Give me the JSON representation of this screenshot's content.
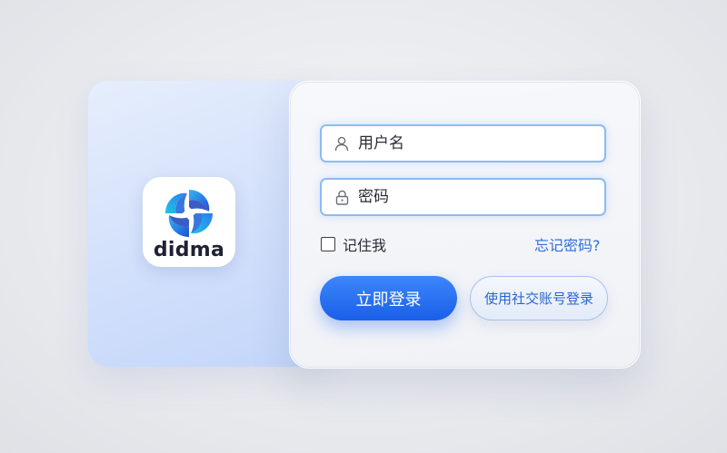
{
  "brand": {
    "name": "didma",
    "accent_color": "#1a5fe8"
  },
  "form": {
    "username": {
      "placeholder": "用户名",
      "icon": "user-icon"
    },
    "password": {
      "placeholder": "密码",
      "icon": "lock-icon"
    },
    "remember_label": "记住我",
    "forgot_label": "忘记密码?",
    "login_label": "立即登录",
    "social_login_label": "使用社交账号登录"
  }
}
